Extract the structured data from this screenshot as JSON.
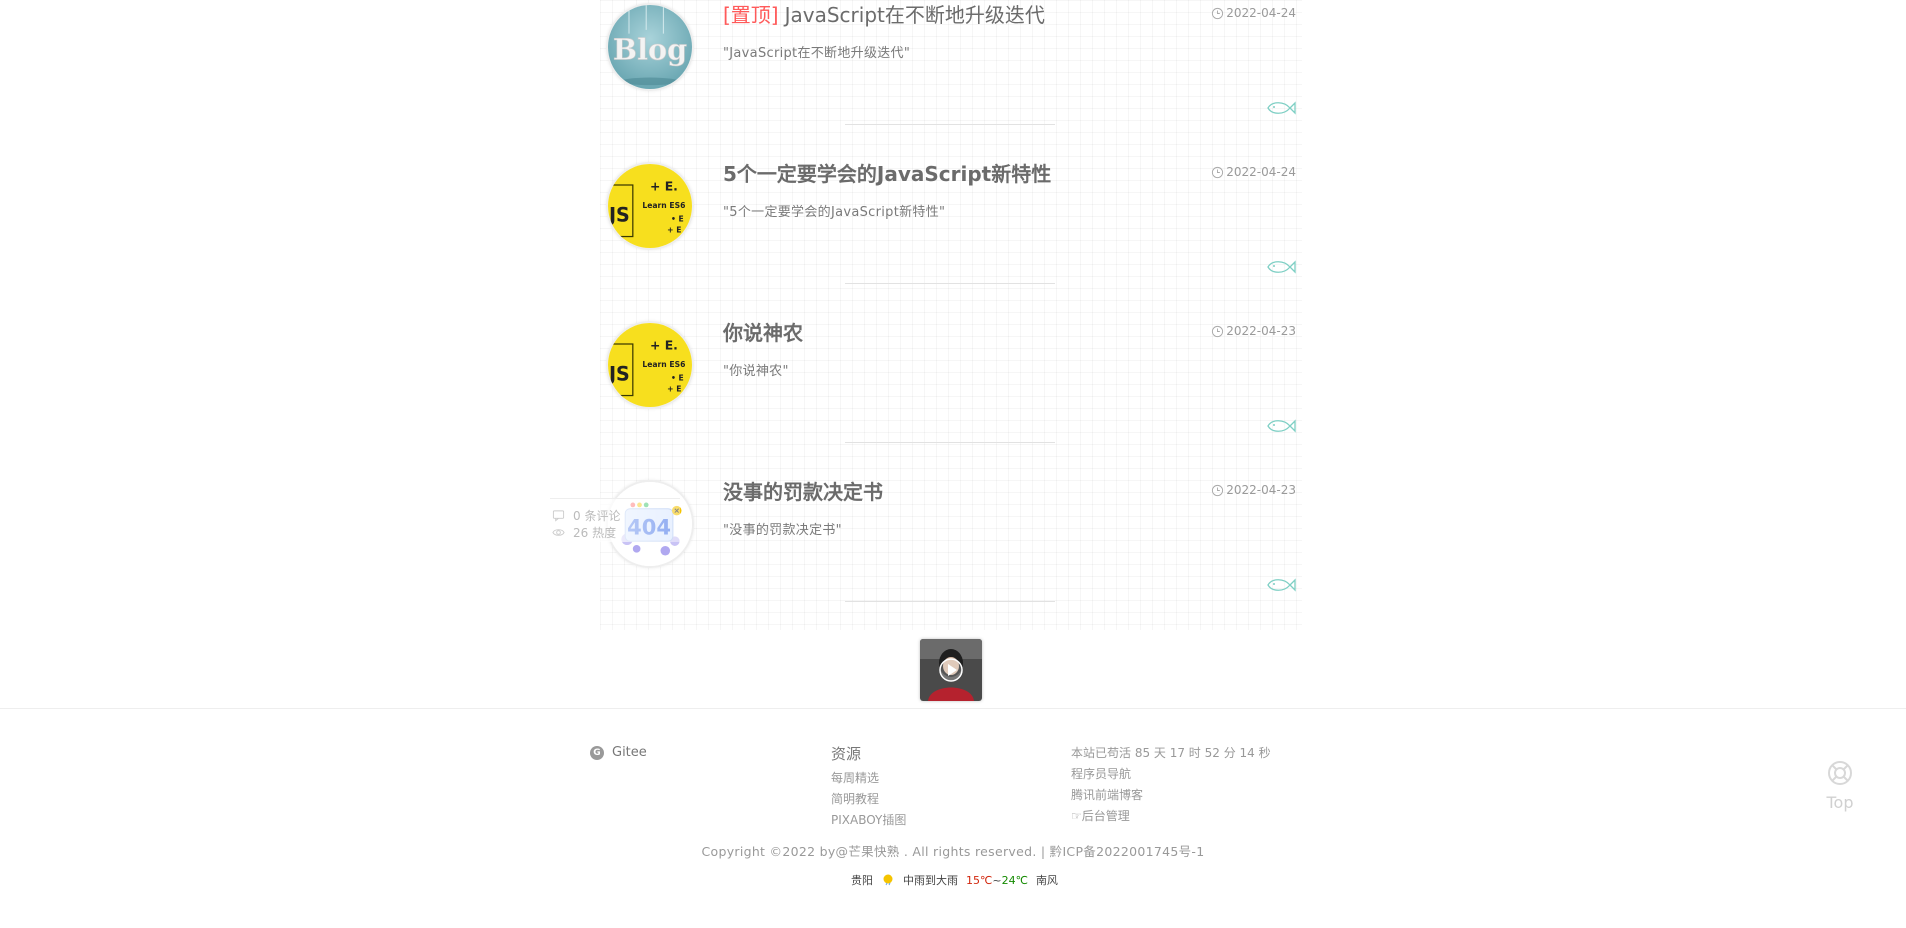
{
  "articles": [
    {
      "pin": "[置顶]",
      "title": "JavaScript在不断地升级迭代",
      "date": "2022-04-24",
      "excerpt": "\"JavaScript在不断地升级迭代\"",
      "thumb": "blog-icon"
    },
    {
      "pin": "",
      "title": "5个一定要学会的JavaScript新特性",
      "date": "2022-04-24",
      "excerpt": "\"5个一定要学会的JavaScript新特性\"",
      "thumb": "js-es6-icon"
    },
    {
      "pin": "",
      "title": "你说神农",
      "date": "2022-04-23",
      "excerpt": "\"你说神农\"",
      "thumb": "js-es6-icon"
    },
    {
      "pin": "",
      "title": "没事的罚款决定书",
      "date": "2022-04-23",
      "excerpt": "\"没事的罚款决定书\"",
      "thumb": "404-icon"
    }
  ],
  "ghost_stats": {
    "comments": "0 条评论",
    "views": "26 热度"
  },
  "footer": {
    "gitee_label": "Gitee",
    "resources": {
      "heading": "资源",
      "links": [
        "每周精选",
        "简明教程",
        "PIXABOY插图"
      ]
    },
    "site_info": {
      "uptime": "本站已苟活 85 天 17 时 52 分 14 秒",
      "links": [
        "程序员导航",
        "腾讯前端博客",
        "☞后台管理"
      ]
    },
    "copyright": "Copyright ©2022 by@芒果快熟 . All rights reserved. | 黔ICP备2022001745号-1"
  },
  "weather": {
    "city": "贵阳",
    "condition": "中雨到大雨",
    "low": "15℃",
    "sep": "~",
    "high": "24℃",
    "wind": "南风"
  },
  "top_button": {
    "label": "Top"
  },
  "colors": {
    "pin": "#ff5a5a",
    "fish": "#7ecfc4",
    "js_yellow": "#f7df1e"
  }
}
